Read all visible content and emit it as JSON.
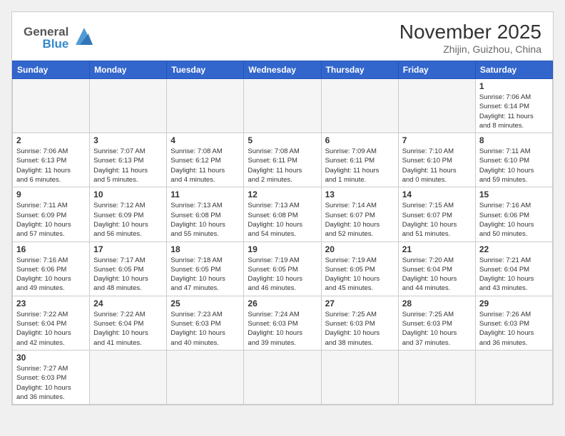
{
  "header": {
    "month_title": "November 2025",
    "subtitle": "Zhijin, Guizhou, China",
    "logo_general": "General",
    "logo_blue": "Blue"
  },
  "weekdays": [
    "Sunday",
    "Monday",
    "Tuesday",
    "Wednesday",
    "Thursday",
    "Friday",
    "Saturday"
  ],
  "weeks": [
    [
      {
        "day": "",
        "info": ""
      },
      {
        "day": "",
        "info": ""
      },
      {
        "day": "",
        "info": ""
      },
      {
        "day": "",
        "info": ""
      },
      {
        "day": "",
        "info": ""
      },
      {
        "day": "",
        "info": ""
      },
      {
        "day": "1",
        "info": "Sunrise: 7:06 AM\nSunset: 6:14 PM\nDaylight: 11 hours\nand 8 minutes."
      }
    ],
    [
      {
        "day": "2",
        "info": "Sunrise: 7:06 AM\nSunset: 6:13 PM\nDaylight: 11 hours\nand 6 minutes."
      },
      {
        "day": "3",
        "info": "Sunrise: 7:07 AM\nSunset: 6:13 PM\nDaylight: 11 hours\nand 5 minutes."
      },
      {
        "day": "4",
        "info": "Sunrise: 7:08 AM\nSunset: 6:12 PM\nDaylight: 11 hours\nand 4 minutes."
      },
      {
        "day": "5",
        "info": "Sunrise: 7:08 AM\nSunset: 6:11 PM\nDaylight: 11 hours\nand 2 minutes."
      },
      {
        "day": "6",
        "info": "Sunrise: 7:09 AM\nSunset: 6:11 PM\nDaylight: 11 hours\nand 1 minute."
      },
      {
        "day": "7",
        "info": "Sunrise: 7:10 AM\nSunset: 6:10 PM\nDaylight: 11 hours\nand 0 minutes."
      },
      {
        "day": "8",
        "info": "Sunrise: 7:11 AM\nSunset: 6:10 PM\nDaylight: 10 hours\nand 59 minutes."
      }
    ],
    [
      {
        "day": "9",
        "info": "Sunrise: 7:11 AM\nSunset: 6:09 PM\nDaylight: 10 hours\nand 57 minutes."
      },
      {
        "day": "10",
        "info": "Sunrise: 7:12 AM\nSunset: 6:09 PM\nDaylight: 10 hours\nand 56 minutes."
      },
      {
        "day": "11",
        "info": "Sunrise: 7:13 AM\nSunset: 6:08 PM\nDaylight: 10 hours\nand 55 minutes."
      },
      {
        "day": "12",
        "info": "Sunrise: 7:13 AM\nSunset: 6:08 PM\nDaylight: 10 hours\nand 54 minutes."
      },
      {
        "day": "13",
        "info": "Sunrise: 7:14 AM\nSunset: 6:07 PM\nDaylight: 10 hours\nand 52 minutes."
      },
      {
        "day": "14",
        "info": "Sunrise: 7:15 AM\nSunset: 6:07 PM\nDaylight: 10 hours\nand 51 minutes."
      },
      {
        "day": "15",
        "info": "Sunrise: 7:16 AM\nSunset: 6:06 PM\nDaylight: 10 hours\nand 50 minutes."
      }
    ],
    [
      {
        "day": "16",
        "info": "Sunrise: 7:16 AM\nSunset: 6:06 PM\nDaylight: 10 hours\nand 49 minutes."
      },
      {
        "day": "17",
        "info": "Sunrise: 7:17 AM\nSunset: 6:05 PM\nDaylight: 10 hours\nand 48 minutes."
      },
      {
        "day": "18",
        "info": "Sunrise: 7:18 AM\nSunset: 6:05 PM\nDaylight: 10 hours\nand 47 minutes."
      },
      {
        "day": "19",
        "info": "Sunrise: 7:19 AM\nSunset: 6:05 PM\nDaylight: 10 hours\nand 46 minutes."
      },
      {
        "day": "20",
        "info": "Sunrise: 7:19 AM\nSunset: 6:05 PM\nDaylight: 10 hours\nand 45 minutes."
      },
      {
        "day": "21",
        "info": "Sunrise: 7:20 AM\nSunset: 6:04 PM\nDaylight: 10 hours\nand 44 minutes."
      },
      {
        "day": "22",
        "info": "Sunrise: 7:21 AM\nSunset: 6:04 PM\nDaylight: 10 hours\nand 43 minutes."
      }
    ],
    [
      {
        "day": "23",
        "info": "Sunrise: 7:22 AM\nSunset: 6:04 PM\nDaylight: 10 hours\nand 42 minutes."
      },
      {
        "day": "24",
        "info": "Sunrise: 7:22 AM\nSunset: 6:04 PM\nDaylight: 10 hours\nand 41 minutes."
      },
      {
        "day": "25",
        "info": "Sunrise: 7:23 AM\nSunset: 6:03 PM\nDaylight: 10 hours\nand 40 minutes."
      },
      {
        "day": "26",
        "info": "Sunrise: 7:24 AM\nSunset: 6:03 PM\nDaylight: 10 hours\nand 39 minutes."
      },
      {
        "day": "27",
        "info": "Sunrise: 7:25 AM\nSunset: 6:03 PM\nDaylight: 10 hours\nand 38 minutes."
      },
      {
        "day": "28",
        "info": "Sunrise: 7:25 AM\nSunset: 6:03 PM\nDaylight: 10 hours\nand 37 minutes."
      },
      {
        "day": "29",
        "info": "Sunrise: 7:26 AM\nSunset: 6:03 PM\nDaylight: 10 hours\nand 36 minutes."
      }
    ],
    [
      {
        "day": "30",
        "info": "Sunrise: 7:27 AM\nSunset: 6:03 PM\nDaylight: 10 hours\nand 36 minutes."
      },
      {
        "day": "",
        "info": ""
      },
      {
        "day": "",
        "info": ""
      },
      {
        "day": "",
        "info": ""
      },
      {
        "day": "",
        "info": ""
      },
      {
        "day": "",
        "info": ""
      },
      {
        "day": "",
        "info": ""
      }
    ]
  ]
}
